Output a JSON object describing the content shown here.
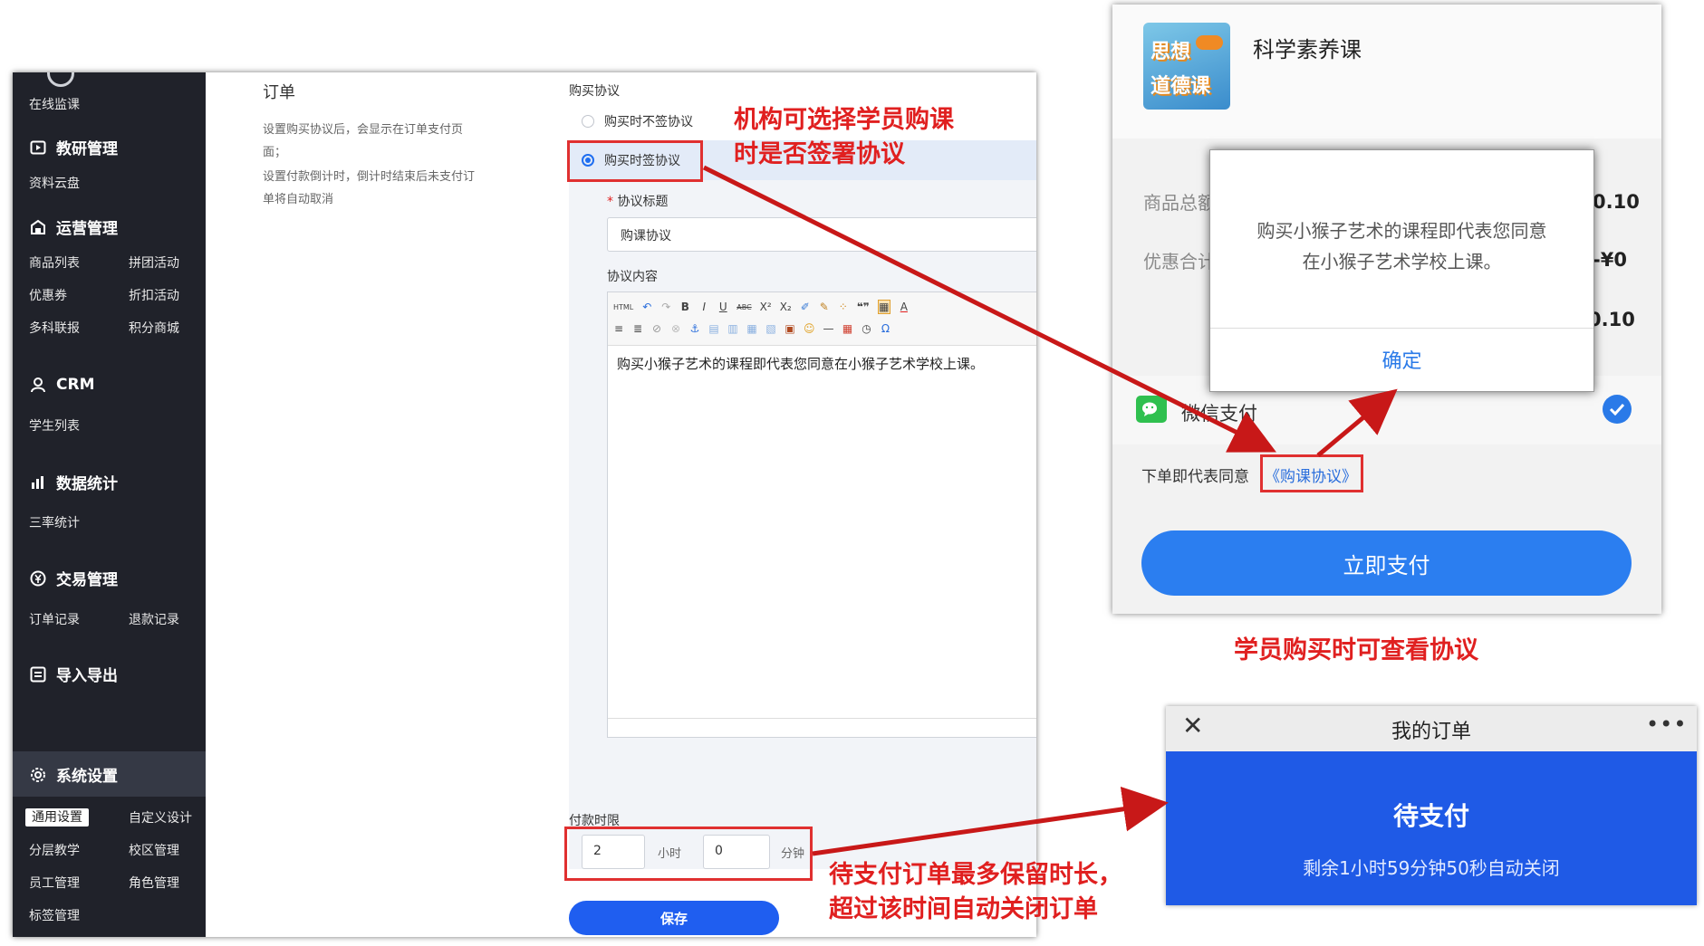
{
  "admin": {
    "sidebar": {
      "top_item": "在线监课",
      "sections": [
        {
          "title": "教研管理",
          "icon": "play-square-icon",
          "items": [
            "资料云盘"
          ]
        },
        {
          "title": "运营管理",
          "icon": "shop-icon",
          "items": [
            "商品列表",
            "拼团活动",
            "优惠券",
            "折扣活动",
            "多科联报",
            "积分商城"
          ]
        },
        {
          "title": "CRM",
          "icon": "user-icon",
          "items": [
            "学生列表"
          ]
        },
        {
          "title": "数据统计",
          "icon": "bar-chart-icon",
          "items": [
            "三率统计"
          ]
        },
        {
          "title": "交易管理",
          "icon": "transaction-icon",
          "items": [
            "订单记录",
            "退款记录"
          ]
        },
        {
          "title": "导入导出",
          "icon": "import-export-icon",
          "items": []
        },
        {
          "title": "系统设置",
          "icon": "gear-icon",
          "items": [
            "通用设置",
            "自定义设计",
            "分层教学",
            "校区管理",
            "员工管理",
            "角色管理",
            "标签管理"
          ]
        }
      ]
    },
    "order_section": {
      "title": "订单",
      "desc1": "设置购买协议后，会显示在订单支付页",
      "desc2": "面；",
      "desc3": "设置付款倒计时，倒计时结束后未支付订",
      "desc4": "单将自动取消"
    },
    "agreement": {
      "label": "购买协议",
      "option_unsigned": "购买时不签协议",
      "option_signed": "购买时签协议",
      "selected": "购买时签协议",
      "title_label": "协议标题",
      "title_value": "购课协议",
      "content_label": "协议内容",
      "content_text": "购买小猴子艺术的课程即代表您同意在小猴子艺术学校上课。"
    },
    "editor_toolbar_row1": [
      "HTML",
      "↶",
      "↷",
      "B",
      "I",
      "U",
      "ABC",
      "X²",
      "X₂",
      "✐",
      "✎",
      "⁘",
      "❝❞",
      "▦",
      "A"
    ],
    "editor_toolbar_row2": [
      "≡",
      "≣",
      "⊘",
      "⊗",
      "⚓",
      "▤",
      "▥",
      "▦",
      "▧",
      "▣",
      "☺",
      "—",
      "▦",
      "◷",
      "Ω"
    ],
    "payment_limit": {
      "label": "付款时限",
      "hours": "2",
      "hours_unit": "小时",
      "minutes": "0",
      "minutes_unit": "分钟"
    },
    "save_label": "保存"
  },
  "annotations": {
    "agreement_note_line1": "机构可选择学员购课",
    "agreement_note_line2": "时是否签署协议",
    "view_note": "学员购买时可查看协议",
    "timeout_note_line1": "待支付订单最多保留时长，",
    "timeout_note_line2": "超过该时间自动关闭订单"
  },
  "checkout": {
    "course_name": "科学素养课",
    "thumbnail_text1": "思想",
    "thumbnail_text2": "道德课",
    "total_label": "商品总额",
    "total_value": "0.10",
    "discount_label": "优惠合计",
    "discount_value": "-¥0",
    "payable_value": "0.10",
    "dialog_text_line1": "购买小猴子艺术的课程即代表您同意",
    "dialog_text_line2": "在小猴子艺术学校上课。",
    "dialog_confirm": "确定",
    "wechat_pay": "微信支付",
    "consent_prefix": "下单即代表同意",
    "consent_link": "《购课协议》",
    "pay_button": "立即支付"
  },
  "my_order": {
    "title": "我的订单",
    "status": "待支付",
    "countdown": "剩余1小时59分钟50秒自动关闭"
  },
  "colors": {
    "sidebar_bg": "#20222a",
    "primary_blue": "#1f5ef0",
    "annotation_red": "#e02020",
    "wechat_green": "#2fc04f"
  }
}
